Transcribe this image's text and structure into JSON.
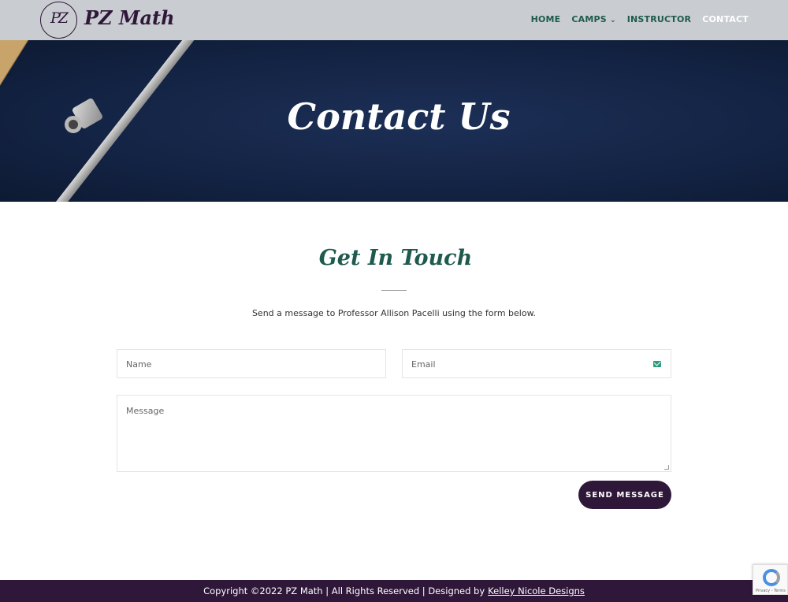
{
  "header": {
    "logo_text": "PZ",
    "brand": "PZ Math",
    "nav": [
      {
        "label": "HOME"
      },
      {
        "label": "CAMPS"
      },
      {
        "label": "INSTRUCTOR"
      },
      {
        "label": "CONTACT"
      }
    ]
  },
  "hero": {
    "title": "Contact Us",
    "background_color": "#142445"
  },
  "contact": {
    "title": "Get In Touch",
    "intro": "Send a message to Professor Allison Pacelli using the form below.",
    "name_placeholder": "Name",
    "email_placeholder": "Email",
    "message_placeholder": "Message",
    "send_label": "SEND MESSAGE"
  },
  "footer": {
    "text": "Copyright ©2022 PZ Math | All Rights Reserved | Designed by",
    "link": "Kelley Nicole Designs"
  },
  "recaptcha": {
    "text": "Privacy - Terms"
  },
  "colors": {
    "accent": "#2f1739",
    "teal": "#1e5a4e",
    "header_bg": "#c9cdd1"
  }
}
